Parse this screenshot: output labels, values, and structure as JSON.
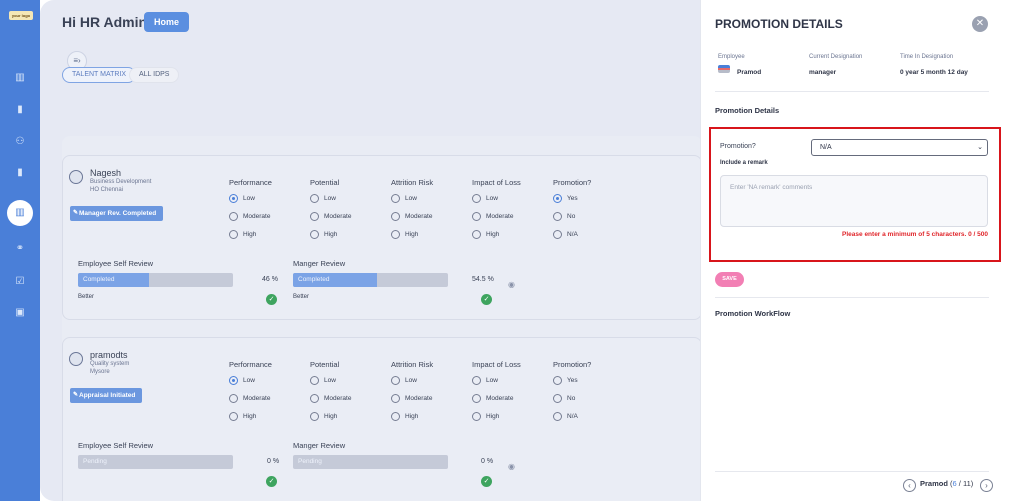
{
  "app": {
    "logo_text": "your logo",
    "greeting": "Hi HR Admin",
    "home_label": "Home"
  },
  "tabs": [
    {
      "label": "TALENT MATRIX",
      "active": true
    },
    {
      "label": "ALL IDPS",
      "active": false
    }
  ],
  "sidebar": {
    "icons": [
      "bar-chart-icon",
      "book-icon",
      "users-icon",
      "book-icon",
      "bar-chart-icon",
      "handshake-icon",
      "checklist-icon",
      "calendar-icon"
    ],
    "active_index": 4
  },
  "column_headers": [
    "Performance",
    "Potential",
    "Attrition Risk",
    "Impact of Loss",
    "Promotion?"
  ],
  "level_options": [
    "Low",
    "Moderate",
    "High"
  ],
  "promotion_options": [
    "Yes",
    "No",
    "N/A"
  ],
  "review_headers": {
    "self": "Employee Self Review",
    "manager": "Manger Review"
  },
  "employees": [
    {
      "name": "Nagesh",
      "department": "Business Development",
      "location": "HO Chennai",
      "status": "Manager Rev. Completed",
      "selected": {
        "performance": "Low",
        "potential": null,
        "attrition": null,
        "impact": null,
        "promotion": "Yes"
      },
      "self_review": {
        "label": "Completed",
        "percent": 46,
        "percent_text": "46 %",
        "rating": "Better",
        "done": true
      },
      "manager_review": {
        "label": "Completed",
        "percent": 54.5,
        "percent_text": "54.5 %",
        "rating": "Better",
        "done": true
      }
    },
    {
      "name": "pramodts",
      "department": "Quality system",
      "location": "Mysore",
      "status": "Appraisal Initiated",
      "selected": {
        "performance": "Low",
        "potential": null,
        "attrition": null,
        "impact": null,
        "promotion": null
      },
      "self_review": {
        "label": "Pending",
        "percent": 0,
        "percent_text": "0 %",
        "rating": "",
        "done": true
      },
      "manager_review": {
        "label": "Pending",
        "percent": 0,
        "percent_text": "0 %",
        "rating": "",
        "done": true
      }
    }
  ],
  "panel": {
    "title": "PROMOTION DETAILS",
    "employee_label": "Employee",
    "employee_name": "Pramod",
    "designation_label": "Current Designation",
    "designation_value": "manager",
    "time_label": "Time In Designation",
    "time_value": "0 year 5 month 12 day",
    "section_promotion": "Promotion Details",
    "promotion_question": "Promotion?",
    "promotion_value": "N/A",
    "remark_label": "Include a remark",
    "remark_placeholder": "Enter 'NA remark' comments",
    "error_text": "Please enter a minimum of 5 characters. 0 / 500",
    "save_label": "SAVE",
    "section_workflow": "Promotion WorkFlow",
    "pager": {
      "name": "Pramod",
      "current": "6",
      "separator": "/",
      "total": "11"
    }
  },
  "colors": {
    "sidebar": "#4a7fd8",
    "accent": "#5b8fe0",
    "error": "#d8151b",
    "save": "#f27fb4",
    "success": "#3ea45f"
  }
}
